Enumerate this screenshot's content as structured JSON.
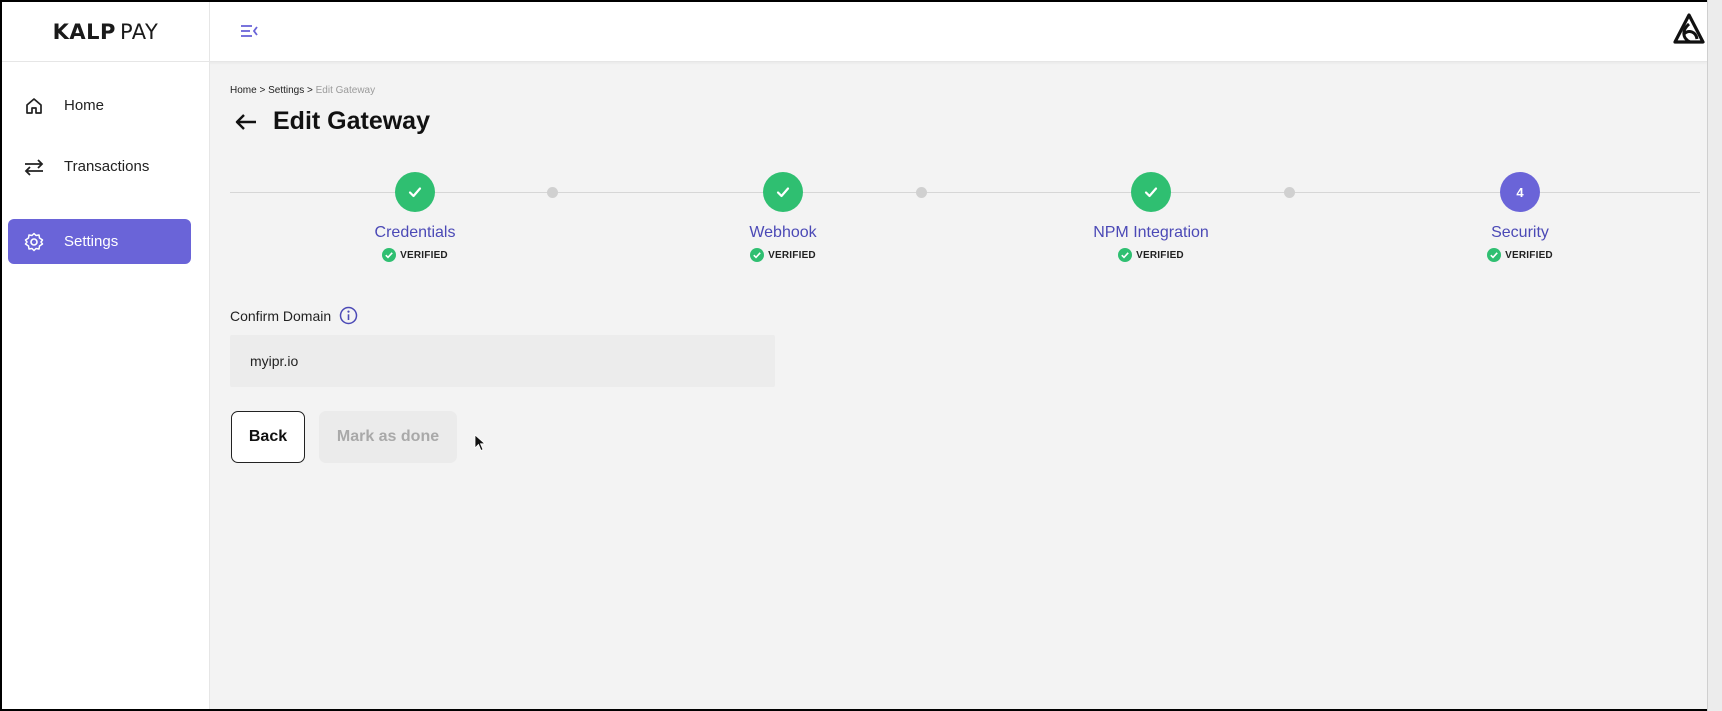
{
  "brand": {
    "part1": "KALP",
    "part2": "PAY"
  },
  "sidebar": {
    "items": [
      {
        "label": "Home",
        "icon": "home-icon"
      },
      {
        "label": "Transactions",
        "icon": "transfer-arrows-icon"
      },
      {
        "label": "Settings",
        "icon": "gear-icon",
        "active": true
      }
    ]
  },
  "breadcrumb": {
    "home": "Home",
    "sep1": " > ",
    "settings": "Settings",
    "sep2": " > ",
    "current": "Edit Gateway"
  },
  "page": {
    "title": "Edit Gateway"
  },
  "stepper": {
    "steps": [
      {
        "label": "Credentials",
        "status": "VERIFIED",
        "state": "done"
      },
      {
        "label": "Webhook",
        "status": "VERIFIED",
        "state": "done"
      },
      {
        "label": "NPM Integration",
        "status": "VERIFIED",
        "state": "done"
      },
      {
        "label": "Security",
        "status": "VERIFIED",
        "state": "current",
        "number": "4"
      }
    ]
  },
  "form": {
    "label": "Confirm Domain",
    "value": "myipr.io"
  },
  "buttons": {
    "back": "Back",
    "done": "Mark as done"
  },
  "colors": {
    "accent": "#6a64d8",
    "success": "#2fbf71",
    "step_label": "#4b49b6"
  }
}
